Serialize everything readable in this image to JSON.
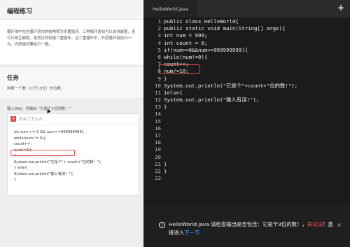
{
  "lesson": {
    "title": "编程练习",
    "text": "循环体中包含循环语句的结构称为多重循环。三种循环语句可以自身嵌套，也可以相互嵌套，最常见的就是二重循环。在二重循环中，外层循环每执行一次，内层循环要执行一圈。"
  },
  "task": {
    "title": "任务",
    "desc": "判断一个数（小于10位）的位数。",
    "input": "输入999，则输出 “它是个3位的数！”"
  },
  "hint": {
    "badge": "?",
    "title": "不会了怎么办",
    "lines": [
      "int num >= 0  && num<=999999999{",
      "while(num != 0){",
      "count++;",
      "num/=10;",
      "}",
      "System.out.println(\"它是个\"+ count+\"位的数！\");",
      "} else{",
      "System.out.println(\"输入有误！\");",
      "}"
    ]
  },
  "editor": {
    "tab": "HelloWorld.java",
    "add_icon": "+",
    "line_numbers": [
      "1",
      "2",
      "3",
      "4",
      "5",
      "6",
      "7",
      "8",
      "9",
      "10",
      "11",
      "12",
      "13",
      "14",
      "15",
      "16",
      "17",
      "18",
      "19",
      "20",
      "21",
      "22",
      "23"
    ],
    "code": [
      "public class HelloWorld{",
      "public static void main(String[] args){",
      "int num = 999;",
      "int count = 0;",
      "if(num>=0&&num<=999999999){",
      "while(num!=0){",
      "count++;",
      "num/=10;",
      "}",
      "System.out.println(\"它是个\"+count+\"位的数!\");",
      "}else{",
      "System.out.println(\"输入有误!\");",
      "}",
      "",
      "",
      "",
      "",
      "",
      "",
      "",
      "}",
      "}",
      ""
    ]
  },
  "message": {
    "icon": "!",
    "text_main": "HelloWorld.java 请检查输出是否包含：它是个3位的数！，",
    "retry": "再试试",
    "text_mid": "！直接进入",
    "next": "下一节",
    "close": "×"
  }
}
